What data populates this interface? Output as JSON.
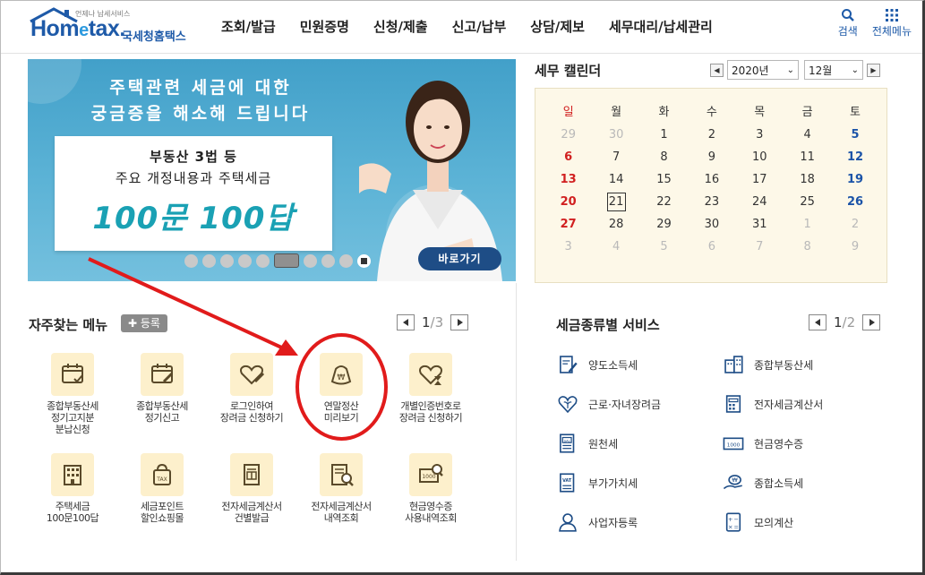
{
  "header": {
    "logo": {
      "word": "Hometax",
      "sub": "언제나 납세서비스",
      "name": "국세청홈택스"
    },
    "nav": [
      "조회/발급",
      "민원증명",
      "신청/제출",
      "신고/납부",
      "상담/제보",
      "세무대리/납세관리"
    ],
    "tools": [
      {
        "label": "검색",
        "icon": "search-icon"
      },
      {
        "label": "전체메뉴",
        "icon": "grid-menu-icon"
      }
    ]
  },
  "banner": {
    "headline_1": "주택관련 세금에 대한",
    "headline_2": "궁금증을 해소해 드립니다",
    "board_line_1": "부동산 3법 등",
    "board_line_2": "주요 개정내용과 주택세금",
    "board_line_3": "100문 100답",
    "cta": "바로가기",
    "slide_count": 9,
    "active_slide": 6
  },
  "calendar": {
    "title": "세무 캘린더",
    "year": "2020년",
    "month": "12월",
    "weekdays": [
      "일",
      "월",
      "화",
      "수",
      "목",
      "금",
      "토"
    ],
    "weeks": [
      [
        "29",
        "30",
        "1",
        "2",
        "3",
        "4",
        "5"
      ],
      [
        "6",
        "7",
        "8",
        "9",
        "10",
        "11",
        "12"
      ],
      [
        "13",
        "14",
        "15",
        "16",
        "17",
        "18",
        "19"
      ],
      [
        "20",
        "21",
        "22",
        "23",
        "24",
        "25",
        "26"
      ],
      [
        "27",
        "28",
        "29",
        "30",
        "31",
        "1",
        "2"
      ],
      [
        "3",
        "4",
        "5",
        "6",
        "7",
        "8",
        "9"
      ]
    ],
    "today": "21"
  },
  "favorites": {
    "title": "자주찾는 메뉴",
    "register": "등록",
    "page_current": "1",
    "page_total": "/3",
    "items": [
      {
        "label": "종합부동산세\n정기고지분\n분납신청",
        "icon": "calendar-check-icon"
      },
      {
        "label": "종합부동산세\n정기신고",
        "icon": "calendar-edit-icon"
      },
      {
        "label": "로그인하여\n장려금 신청하기",
        "icon": "heart-pen-icon"
      },
      {
        "label": "연말정산\n미리보기",
        "icon": "money-bag-icon"
      },
      {
        "label": "개별인증번호로\n장려금 신청하기",
        "icon": "heart-hourglass-icon"
      },
      {
        "label": "주택세금\n100문100답",
        "icon": "building-icon"
      },
      {
        "label": "세금포인트\n할인쇼핑몰",
        "icon": "shopping-bag-icon"
      },
      {
        "label": "전자세금계산서\n건별발급",
        "icon": "invoice-icon"
      },
      {
        "label": "전자세금계산서\n내역조회",
        "icon": "invoice-search-icon"
      },
      {
        "label": "현금영수증\n사용내역조회",
        "icon": "receipt-search-icon"
      }
    ]
  },
  "services": {
    "title": "세금종류별 서비스",
    "page_current": "1",
    "page_total": "/2",
    "items": [
      {
        "label": "양도소득세",
        "icon": "document-pen-icon"
      },
      {
        "label": "종합부동산세",
        "icon": "buildings-icon"
      },
      {
        "label": "근로·자녀장려금",
        "icon": "heart-leaf-icon"
      },
      {
        "label": "전자세금계산서",
        "icon": "invoice-grid-icon"
      },
      {
        "label": "원천세",
        "icon": "salary-document-icon"
      },
      {
        "label": "현금영수증",
        "icon": "receipt-1000-icon"
      },
      {
        "label": "부가가치세",
        "icon": "vat-document-icon"
      },
      {
        "label": "종합소득세",
        "icon": "money-hand-icon"
      },
      {
        "label": "사업자등록",
        "icon": "person-icon"
      },
      {
        "label": "모의계산",
        "icon": "calculator-icon"
      }
    ]
  },
  "colors": {
    "brand_blue": "#1e5aa8",
    "banner_teal": "#42a0c9",
    "calendar_bg": "#fdf8e8",
    "sunday_red": "#d12020",
    "saturday_blue": "#1c54a8",
    "icon_bg": "#fdf0cc",
    "annotation_red": "#e11b1b"
  }
}
